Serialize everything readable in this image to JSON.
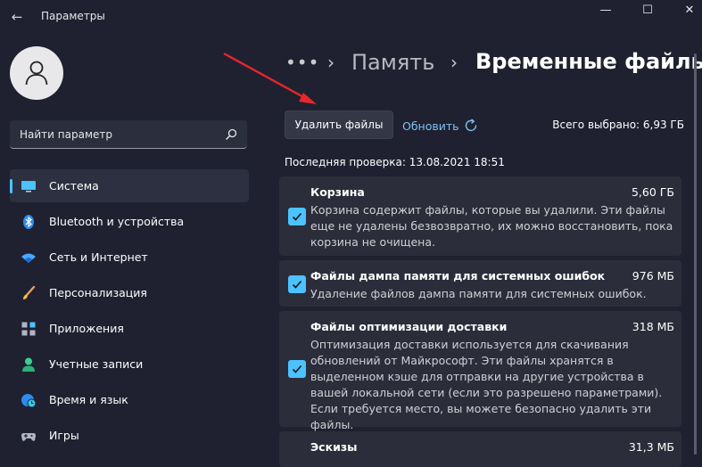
{
  "window": {
    "title": "Параметры",
    "back_glyph": "←",
    "minimize_glyph": "—",
    "maximize_glyph": "☐",
    "close_glyph": "✕"
  },
  "sidebar": {
    "search_placeholder": "Найти параметр",
    "items": [
      {
        "label": "Система",
        "icon": "monitor-icon",
        "active": true
      },
      {
        "label": "Bluetooth и устройства",
        "icon": "bluetooth-icon"
      },
      {
        "label": "Сеть и Интернет",
        "icon": "wifi-icon"
      },
      {
        "label": "Персонализация",
        "icon": "brush-icon"
      },
      {
        "label": "Приложения",
        "icon": "apps-icon"
      },
      {
        "label": "Учетные записи",
        "icon": "person-icon"
      },
      {
        "label": "Время и язык",
        "icon": "globe-clock-icon"
      },
      {
        "label": "Игры",
        "icon": "gamepad-icon"
      }
    ]
  },
  "breadcrumb": {
    "dots": "•••",
    "chevron": "›",
    "parent": "Память",
    "current": "Временные файлы"
  },
  "actions": {
    "delete_label": "Удалить файлы",
    "refresh_label": "Обновить",
    "total_selected": "Всего выбрано: 6,93 ГБ"
  },
  "last_check": "Последняя проверка: 13.08.2021 18:51",
  "categories": [
    {
      "title": "Корзина",
      "size": "5,60 ГБ",
      "checked": true,
      "description": "Корзина содержит файлы, которые вы удалили. Эти файлы еще не удалены безвозвратно, их можно восстановить, пока корзина не очищена."
    },
    {
      "title": "Файлы дампа памяти для системных ошибок",
      "size": "976 МБ",
      "checked": true,
      "description": "Удаление файлов дампа памяти для системных ошибок."
    },
    {
      "title": "Файлы оптимизации доставки",
      "size": "318 МБ",
      "checked": true,
      "description": "Оптимизация доставки используется для скачивания обновлений от Майкрософт. Эти файлы хранятся в выделенном кэше для отправки на другие устройства в вашей локальной сети (если это разрешено параметрами). Если требуется место, вы можете безопасно удалить эти файлы."
    },
    {
      "title": "Эскизы",
      "size": "31,3 МБ"
    }
  ],
  "colors": {
    "accent": "#4cc2ff",
    "annotation_arrow": "#e8262b"
  }
}
